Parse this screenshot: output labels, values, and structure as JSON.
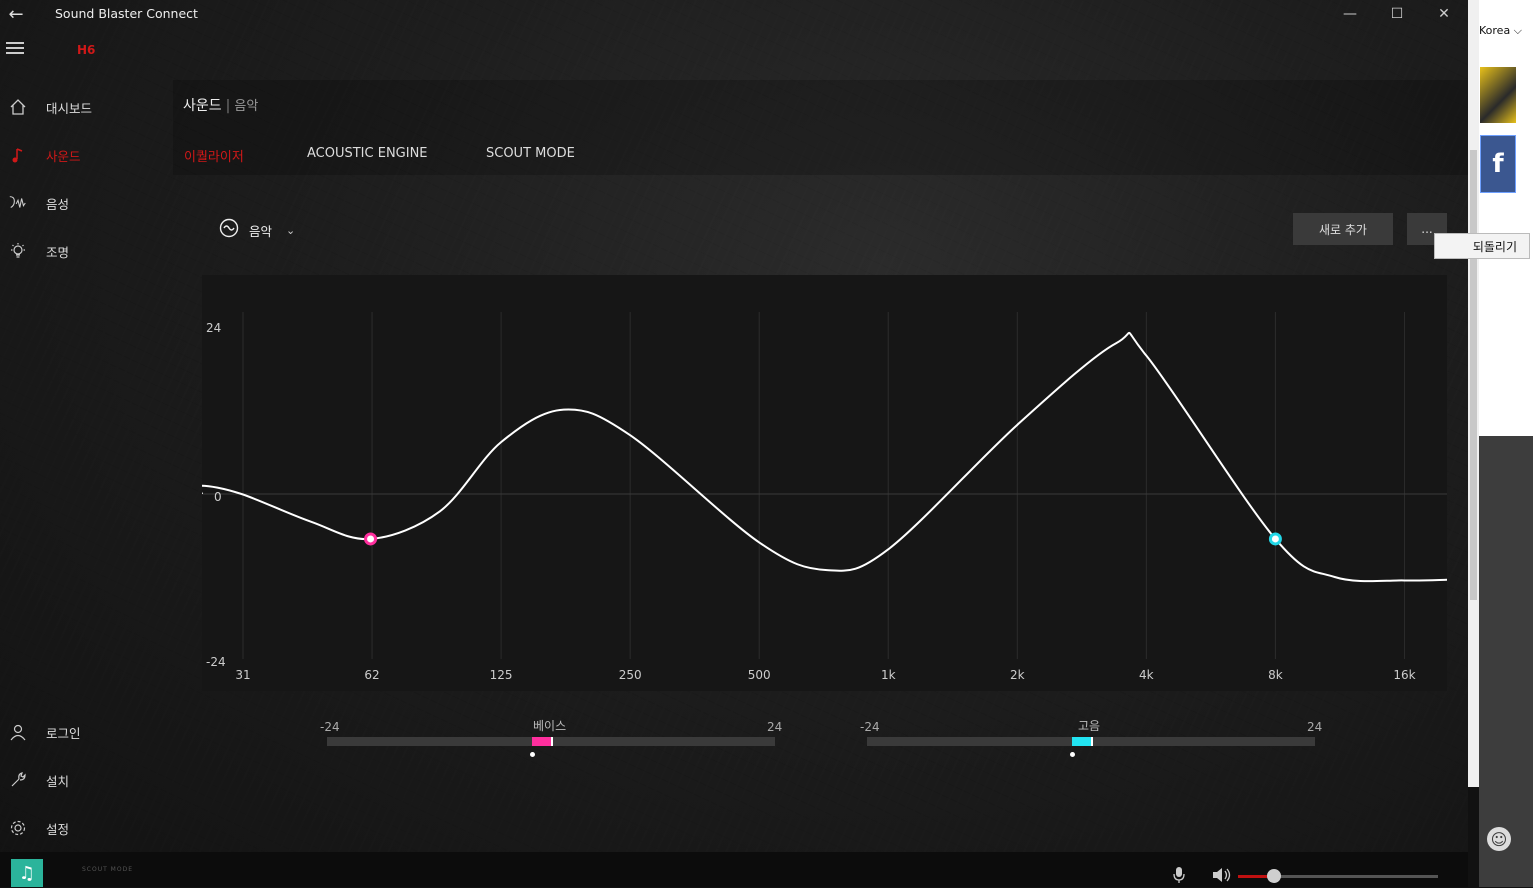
{
  "window": {
    "title": "Sound Blaster Connect",
    "device": "H6",
    "controls": {
      "minimize": "—",
      "maximize": "☐",
      "close": "✕"
    }
  },
  "nav": {
    "top_items": [
      {
        "label": "대시보드",
        "icon": "home-icon"
      },
      {
        "label": "사운드",
        "icon": "music-note-icon",
        "active": true
      },
      {
        "label": "음성",
        "icon": "voice-icon"
      },
      {
        "label": "조명",
        "icon": "lightbulb-icon"
      }
    ],
    "bottom_items": [
      {
        "label": "로그인",
        "icon": "user-icon"
      },
      {
        "label": "설치",
        "icon": "wrench-icon"
      },
      {
        "label": "설정",
        "icon": "gear-icon"
      }
    ]
  },
  "breadcrumb": {
    "section": "사운드",
    "separator": "|",
    "sub": "음악"
  },
  "tabs": [
    {
      "label": "이퀄라이저",
      "active": true
    },
    {
      "label": "ACOUSTIC ENGINE"
    },
    {
      "label": "SCOUT MODE"
    }
  ],
  "preset": {
    "label": "음악",
    "icon": "wave-icon"
  },
  "buttons": {
    "add_new": "새로 추가",
    "more": "..."
  },
  "dropdown": {
    "revert": "되돌리기"
  },
  "chart_data": {
    "type": "line",
    "x": [
      "31",
      "62",
      "125",
      "250",
      "500",
      "1k",
      "2k",
      "4k",
      "8k",
      "16k"
    ],
    "y_ticks": [
      "24",
      "0",
      "-24"
    ],
    "ylim": [
      -24,
      24
    ],
    "curve": [
      {
        "x": "20",
        "y": 0
      },
      {
        "x": "23",
        "y": 1.2
      },
      {
        "x": "31",
        "y": 0
      },
      {
        "x": "45",
        "y": -4.0
      },
      {
        "x": "62",
        "y": -6.5
      },
      {
        "x": "90",
        "y": -2.5
      },
      {
        "x": "125",
        "y": 7.5
      },
      {
        "x": "175",
        "y": 12.2
      },
      {
        "x": "250",
        "y": 8.5
      },
      {
        "x": "500",
        "y": -7.0
      },
      {
        "x": "720",
        "y": -11.0
      },
      {
        "x": "1k",
        "y": -8.0
      },
      {
        "x": "2k",
        "y": 10.0
      },
      {
        "x": "3.4k",
        "y": 21.8
      },
      {
        "x": "4k",
        "y": 20.0
      },
      {
        "x": "8k",
        "y": -6.5
      },
      {
        "x": "11k",
        "y": -12.0
      },
      {
        "x": "16k",
        "y": -12.5
      },
      {
        "x": "22k",
        "y": -12.4
      }
    ],
    "handles": [
      {
        "x": "62",
        "y": -6.5,
        "color": "#ff2f9e"
      },
      {
        "x": "8k",
        "y": -6.5,
        "color": "#22d8e8"
      }
    ],
    "grid": true
  },
  "sliders": [
    {
      "name": "베이스",
      "min_label": "-24",
      "max_label": "24",
      "min": -24,
      "max": 24,
      "value": 0,
      "default": -2,
      "color": "#ff2f9e"
    },
    {
      "name": "고음",
      "min_label": "-24",
      "max_label": "24",
      "min": -24,
      "max": 24,
      "value": 0,
      "default": -2,
      "color": "#22e4f2"
    }
  ],
  "taskbar": {
    "scout_logo": "SCOUT MODE",
    "volume": 0.18,
    "music_icon": "music-note-icon"
  },
  "side_window": {
    "text": "Korea ⌵",
    "thumb_icon": "f"
  },
  "colors": {
    "accent": "#d01818",
    "bass": "#ff2f9e",
    "treble": "#22e4f2"
  }
}
